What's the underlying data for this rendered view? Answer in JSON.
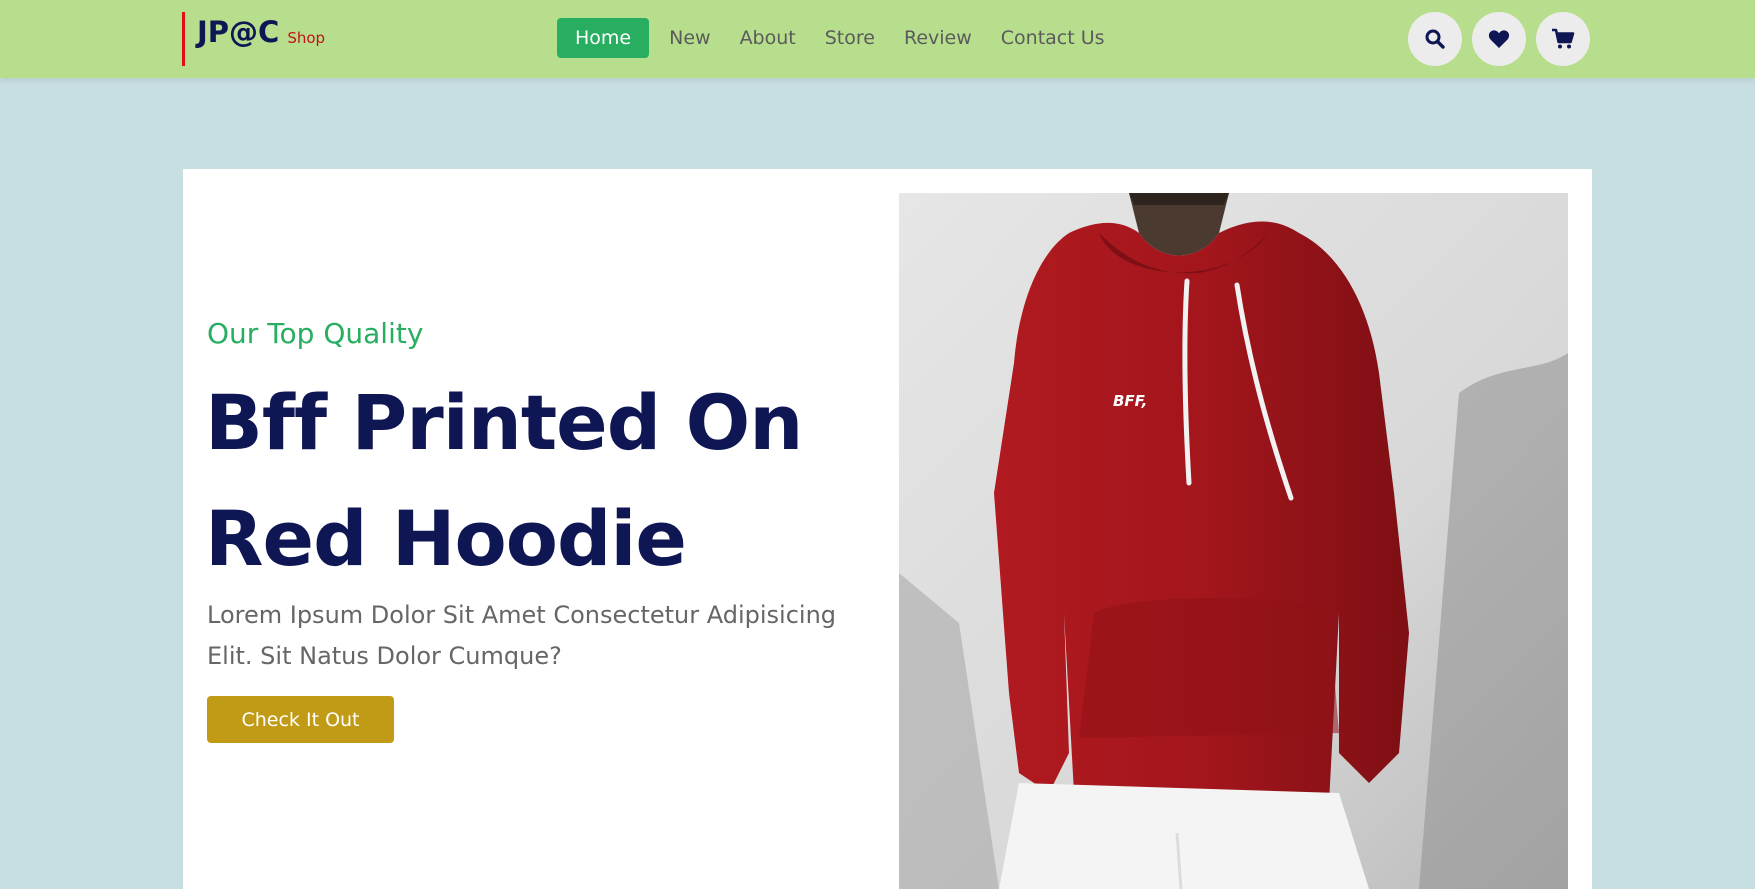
{
  "brand": {
    "name": "JP@C",
    "suffix": "Shop"
  },
  "nav": {
    "items": [
      {
        "label": "Home",
        "active": true
      },
      {
        "label": "New"
      },
      {
        "label": "About"
      },
      {
        "label": "Store"
      },
      {
        "label": "Review"
      },
      {
        "label": "Contact Us"
      }
    ]
  },
  "icons": {
    "search": "search-icon",
    "wishlist": "heart-icon",
    "cart": "cart-icon"
  },
  "hero": {
    "eyebrow": "Our Top Quality",
    "headline": "Bff Printed On Red Hoodie",
    "description": "Lorem Ipsum Dolor Sit Amet Consectetur Adipisicing Elit. Sit Natus Dolor Cumque?",
    "cta_label": "Check It Out",
    "image": {
      "subject": "person-wearing-red-hoodie",
      "print_text": "BFF,"
    }
  },
  "colors": {
    "header_bg": "#b6de8c",
    "page_bg": "#c8dfe2",
    "accent_green": "#27ae60",
    "navy": "#0f1654",
    "cta_gold": "#c19a16",
    "logo_red": "#c0141c",
    "hoodie_red": "#a3161c"
  }
}
